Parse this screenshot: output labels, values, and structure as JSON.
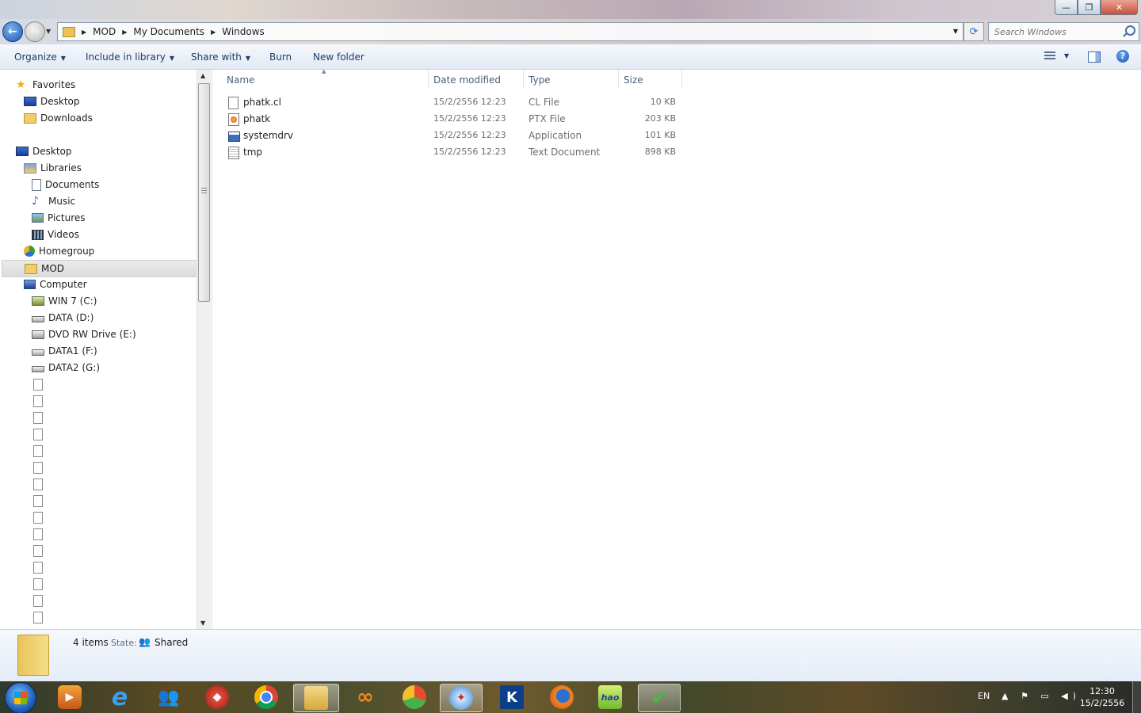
{
  "window": {
    "controls": {
      "minimize": "—",
      "maximize": "❐",
      "close": "✕"
    }
  },
  "address": {
    "crumbs": [
      "MOD",
      "My Documents",
      "Windows"
    ],
    "search_placeholder": "Search Windows"
  },
  "toolbar": {
    "organize": "Organize",
    "include_in_library": "Include in library",
    "share_with": "Share with",
    "burn": "Burn",
    "new_folder": "New folder"
  },
  "nav": {
    "favorites": "Favorites",
    "fav_desktop": "Desktop",
    "fav_downloads": "Downloads",
    "desktop": "Desktop",
    "libraries": "Libraries",
    "documents": "Documents",
    "music": "Music",
    "pictures": "Pictures",
    "videos": "Videos",
    "homegroup": "Homegroup",
    "mod": "MOD",
    "computer": "Computer",
    "drive_c": "WIN 7 (C:)",
    "drive_d": "DATA (D:)",
    "drive_e": "DVD RW Drive (E:)",
    "drive_f": "DATA1 (F:)",
    "drive_g": "DATA2 (G:)"
  },
  "columns": {
    "name": "Name",
    "date": "Date modified",
    "type": "Type",
    "size": "Size"
  },
  "files": [
    {
      "name": "phatk.cl",
      "date": "15/2/2556 12:23",
      "type": "CL File",
      "size": "10 KB",
      "icon": "blank-file-icon"
    },
    {
      "name": "phatk",
      "date": "15/2/2556 12:23",
      "type": "PTX File",
      "size": "203 KB",
      "icon": "ptx-file-icon"
    },
    {
      "name": "systemdrv",
      "date": "15/2/2556 12:23",
      "type": "Application",
      "size": "101 KB",
      "icon": "application-icon"
    },
    {
      "name": "tmp",
      "date": "15/2/2556 12:23",
      "type": "Text Document",
      "size": "898 KB",
      "icon": "text-document-icon"
    }
  ],
  "status": {
    "count": "4 items",
    "state_label": "State:",
    "state_value": "Shared"
  },
  "taskbar": {
    "apps": [
      "windows-media-player",
      "internet-explorer",
      "messenger",
      "app-red",
      "chrome",
      "windows-explorer",
      "app-orange",
      "app-green-ring",
      "safari",
      "app-k",
      "firefox",
      "hao123",
      "app-checkmark"
    ],
    "hao_label": "hao",
    "k_label": "K",
    "language": "EN",
    "tray": "▲ ⚑ ▭ ◀)",
    "time": "12:30",
    "date": "15/2/2556"
  }
}
